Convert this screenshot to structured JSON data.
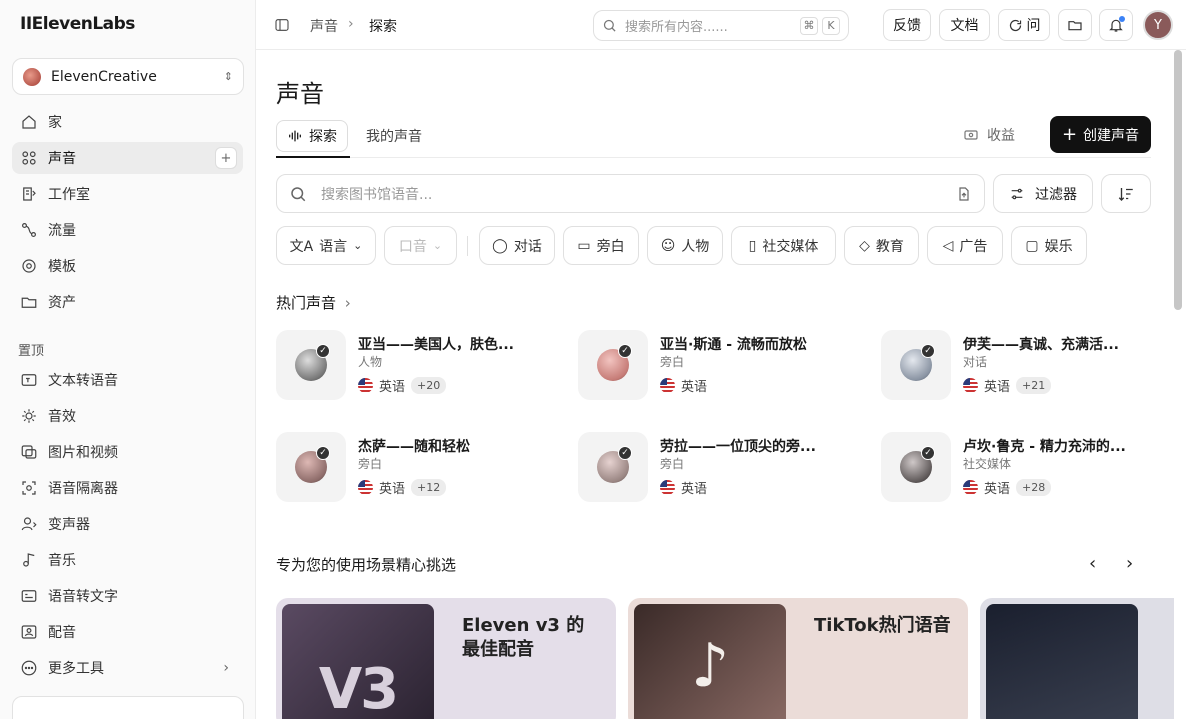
{
  "brand": {
    "logo": "IIElevenLabs"
  },
  "workspace": {
    "name": "ElevenCreative"
  },
  "nav": {
    "home": "家",
    "voices": "声音",
    "studio": "工作室",
    "flows": "流量",
    "templates": "模板",
    "assets": "资产",
    "pinned_label": "置顶",
    "tts": "文本转语音",
    "sfx": "音效",
    "image_video": "图片和视频",
    "isolator": "语音隔离器",
    "changer": "变声器",
    "music": "音乐",
    "stt": "语音转文字",
    "dubbing": "配音",
    "more": "更多工具"
  },
  "topbar": {
    "crumb_root": "声音",
    "crumb_sep": "›",
    "crumb_current": "探索",
    "search_placeholder": "搜索所有内容......",
    "kbd_cmd": "⌘",
    "kbd_k": "K",
    "feedback": "反馈",
    "docs": "文档",
    "ask": "问",
    "avatar": "Y"
  },
  "page": {
    "title": "声音",
    "tab_explore": "探索",
    "tab_my": "我的声音",
    "earn": "收益",
    "create": "创建声音",
    "lib_search_placeholder": "搜索图书馆语音...",
    "filter": "过滤器"
  },
  "chips": {
    "language": "语言",
    "accent": "口音",
    "conversation": "对话",
    "narration": "旁白",
    "character": "人物",
    "social": "社交媒体",
    "education": "教育",
    "ads": "广告",
    "entertainment": "娱乐"
  },
  "hot": {
    "title": "热门声音",
    "voices": [
      {
        "name": "亚当——美国人，肤色...",
        "category": "人物",
        "lang": "英语",
        "extra": "+20"
      },
      {
        "name": "亚当·斯通 - 流畅而放松",
        "category": "旁白",
        "lang": "英语",
        "extra": ""
      },
      {
        "name": "伊芙——真诚、充满活...",
        "category": "对话",
        "lang": "英语",
        "extra": "+21"
      },
      {
        "name": "杰萨——随和轻松",
        "category": "旁白",
        "lang": "英语",
        "extra": "+12"
      },
      {
        "name": "劳拉——一位顶尖的旁...",
        "category": "旁白",
        "lang": "英语",
        "extra": ""
      },
      {
        "name": "卢坎·鲁克 - 精力充沛的...",
        "category": "社交媒体",
        "lang": "英语",
        "extra": "+28"
      }
    ]
  },
  "picks": {
    "title": "专为您的使用场景精心挑选",
    "cards": [
      {
        "title": "Eleven v3 的最佳配音",
        "image_text": "V3"
      },
      {
        "title": "TikTok热门语音",
        "image_text": ""
      }
    ]
  }
}
